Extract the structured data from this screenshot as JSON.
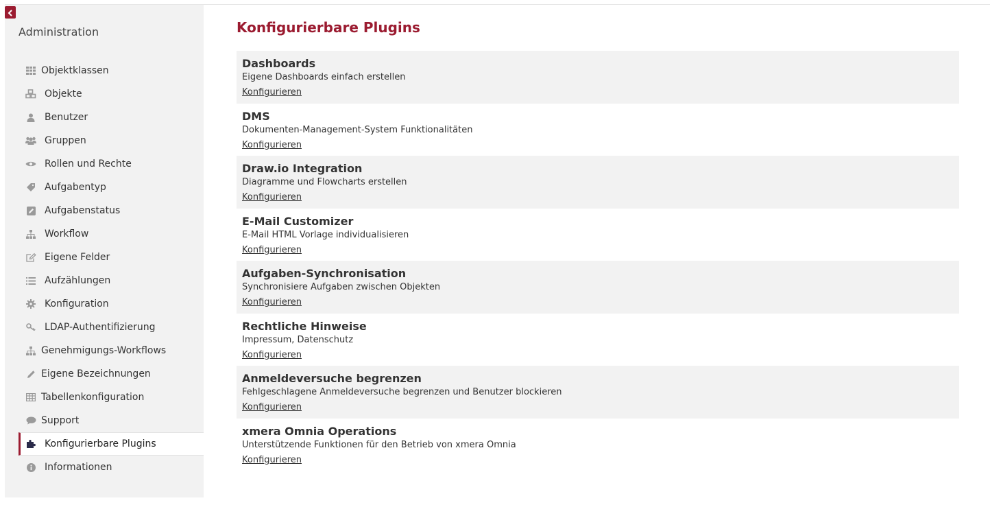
{
  "sidebar": {
    "title": "Administration",
    "items": [
      {
        "label": "Objektklassen",
        "icon": "grid-icon",
        "name": "sidebar-item-objektklassen"
      },
      {
        "label": "Objekte",
        "icon": "cubes-icon",
        "name": "sidebar-item-objekte"
      },
      {
        "label": "Benutzer",
        "icon": "user-icon",
        "name": "sidebar-item-benutzer"
      },
      {
        "label": "Gruppen",
        "icon": "users-icon",
        "name": "sidebar-item-gruppen"
      },
      {
        "label": "Rollen und Rechte",
        "icon": "eye-icon",
        "name": "sidebar-item-rollen-und-rechte"
      },
      {
        "label": "Aufgabentyp",
        "icon": "tag-icon",
        "name": "sidebar-item-aufgabentyp"
      },
      {
        "label": "Aufgabenstatus",
        "icon": "edit-square-icon",
        "name": "sidebar-item-aufgabenstatus"
      },
      {
        "label": "Workflow",
        "icon": "sitemap-icon",
        "name": "sidebar-item-workflow"
      },
      {
        "label": "Eigene Felder",
        "icon": "edit-icon",
        "name": "sidebar-item-eigene-felder"
      },
      {
        "label": "Aufzählungen",
        "icon": "list-icon",
        "name": "sidebar-item-aufzaehlungen"
      },
      {
        "label": "Konfiguration",
        "icon": "gear-icon",
        "name": "sidebar-item-konfiguration"
      },
      {
        "label": "LDAP-Authentifizierung",
        "icon": "key-icon",
        "name": "sidebar-item-ldap-authentifizierung"
      },
      {
        "label": "Genehmigungs-Workflows",
        "icon": "sitemap-icon",
        "name": "sidebar-item-genehmigungs-workflows"
      },
      {
        "label": "Eigene Bezeichnungen",
        "icon": "pencil-icon",
        "name": "sidebar-item-eigene-bezeichnungen"
      },
      {
        "label": "Tabellenkonfiguration",
        "icon": "table-icon",
        "name": "sidebar-item-tabellenkonfiguration"
      },
      {
        "label": "Support",
        "icon": "comment-icon",
        "name": "sidebar-item-support"
      },
      {
        "label": "Konfigurierbare Plugins",
        "icon": "puzzle-icon",
        "name": "sidebar-item-konfigurierbare-plugins"
      },
      {
        "label": "Informationen",
        "icon": "info-icon",
        "name": "sidebar-item-informationen"
      }
    ]
  },
  "main": {
    "title": "Konfigurierbare Plugins",
    "plugins": [
      {
        "name": "Dashboards",
        "description": "Eigene Dashboards einfach erstellen",
        "link": "Konfigurieren"
      },
      {
        "name": "DMS",
        "description": "Dokumenten-Management-System Funktionalitäten",
        "link": "Konfigurieren"
      },
      {
        "name": "Draw.io Integration",
        "description": "Diagramme und Flowcharts erstellen",
        "link": "Konfigurieren"
      },
      {
        "name": "E-Mail Customizer",
        "description": "E-Mail HTML Vorlage individualisieren",
        "link": "Konfigurieren"
      },
      {
        "name": "Aufgaben-Synchronisation",
        "description": "Synchronisiere Aufgaben zwischen Objekten",
        "link": "Konfigurieren"
      },
      {
        "name": "Rechtliche Hinweise",
        "description": "Impressum, Datenschutz",
        "link": "Konfigurieren"
      },
      {
        "name": "Anmeldeversuche begrenzen",
        "description": "Fehlgeschlagene Anmeldeversuche begrenzen und Benutzer blockieren",
        "link": "Konfigurieren"
      },
      {
        "name": "xmera Omnia Operations",
        "description": "Unterstützende Funktionen für den Betrieb von xmera Omnia",
        "link": "Konfigurieren"
      }
    ]
  },
  "colors": {
    "accent": "#9b1b30",
    "sidebar_bg": "#f2f2f2",
    "icon_gray": "#9a9a9a",
    "active_icon": "#2b2b4a"
  }
}
